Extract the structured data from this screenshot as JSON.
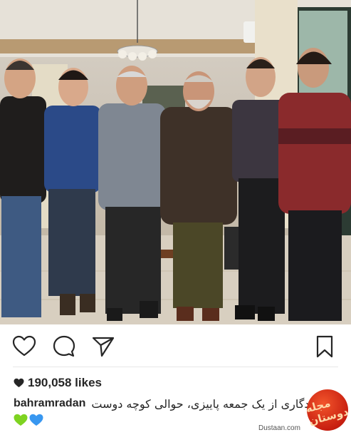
{
  "post": {
    "photo": {
      "icon": "group-photo"
    },
    "actions": {
      "like_icon": "heart-outline-icon",
      "comment_icon": "comment-bubble-icon",
      "share_icon": "paper-plane-icon",
      "save_icon": "bookmark-icon"
    },
    "likes": {
      "icon": "heart-filled-icon",
      "count_label": "190,058 likes"
    },
    "caption": {
      "username": "bahramradan",
      "text": "یادگاری از یک جمعه پاییزی، حوالی کوچه دوست",
      "emojis": [
        "green-heart-icon",
        "blue-heart-icon"
      ]
    }
  },
  "watermark": {
    "logo": "مجله دوستان",
    "url": "Dustaan.com"
  },
  "colors": {
    "text": "#262626",
    "divider": "#e6e6e6",
    "green_heart": "#7ed321",
    "blue_heart": "#3897f0",
    "watermark_red": "#c81f10"
  }
}
